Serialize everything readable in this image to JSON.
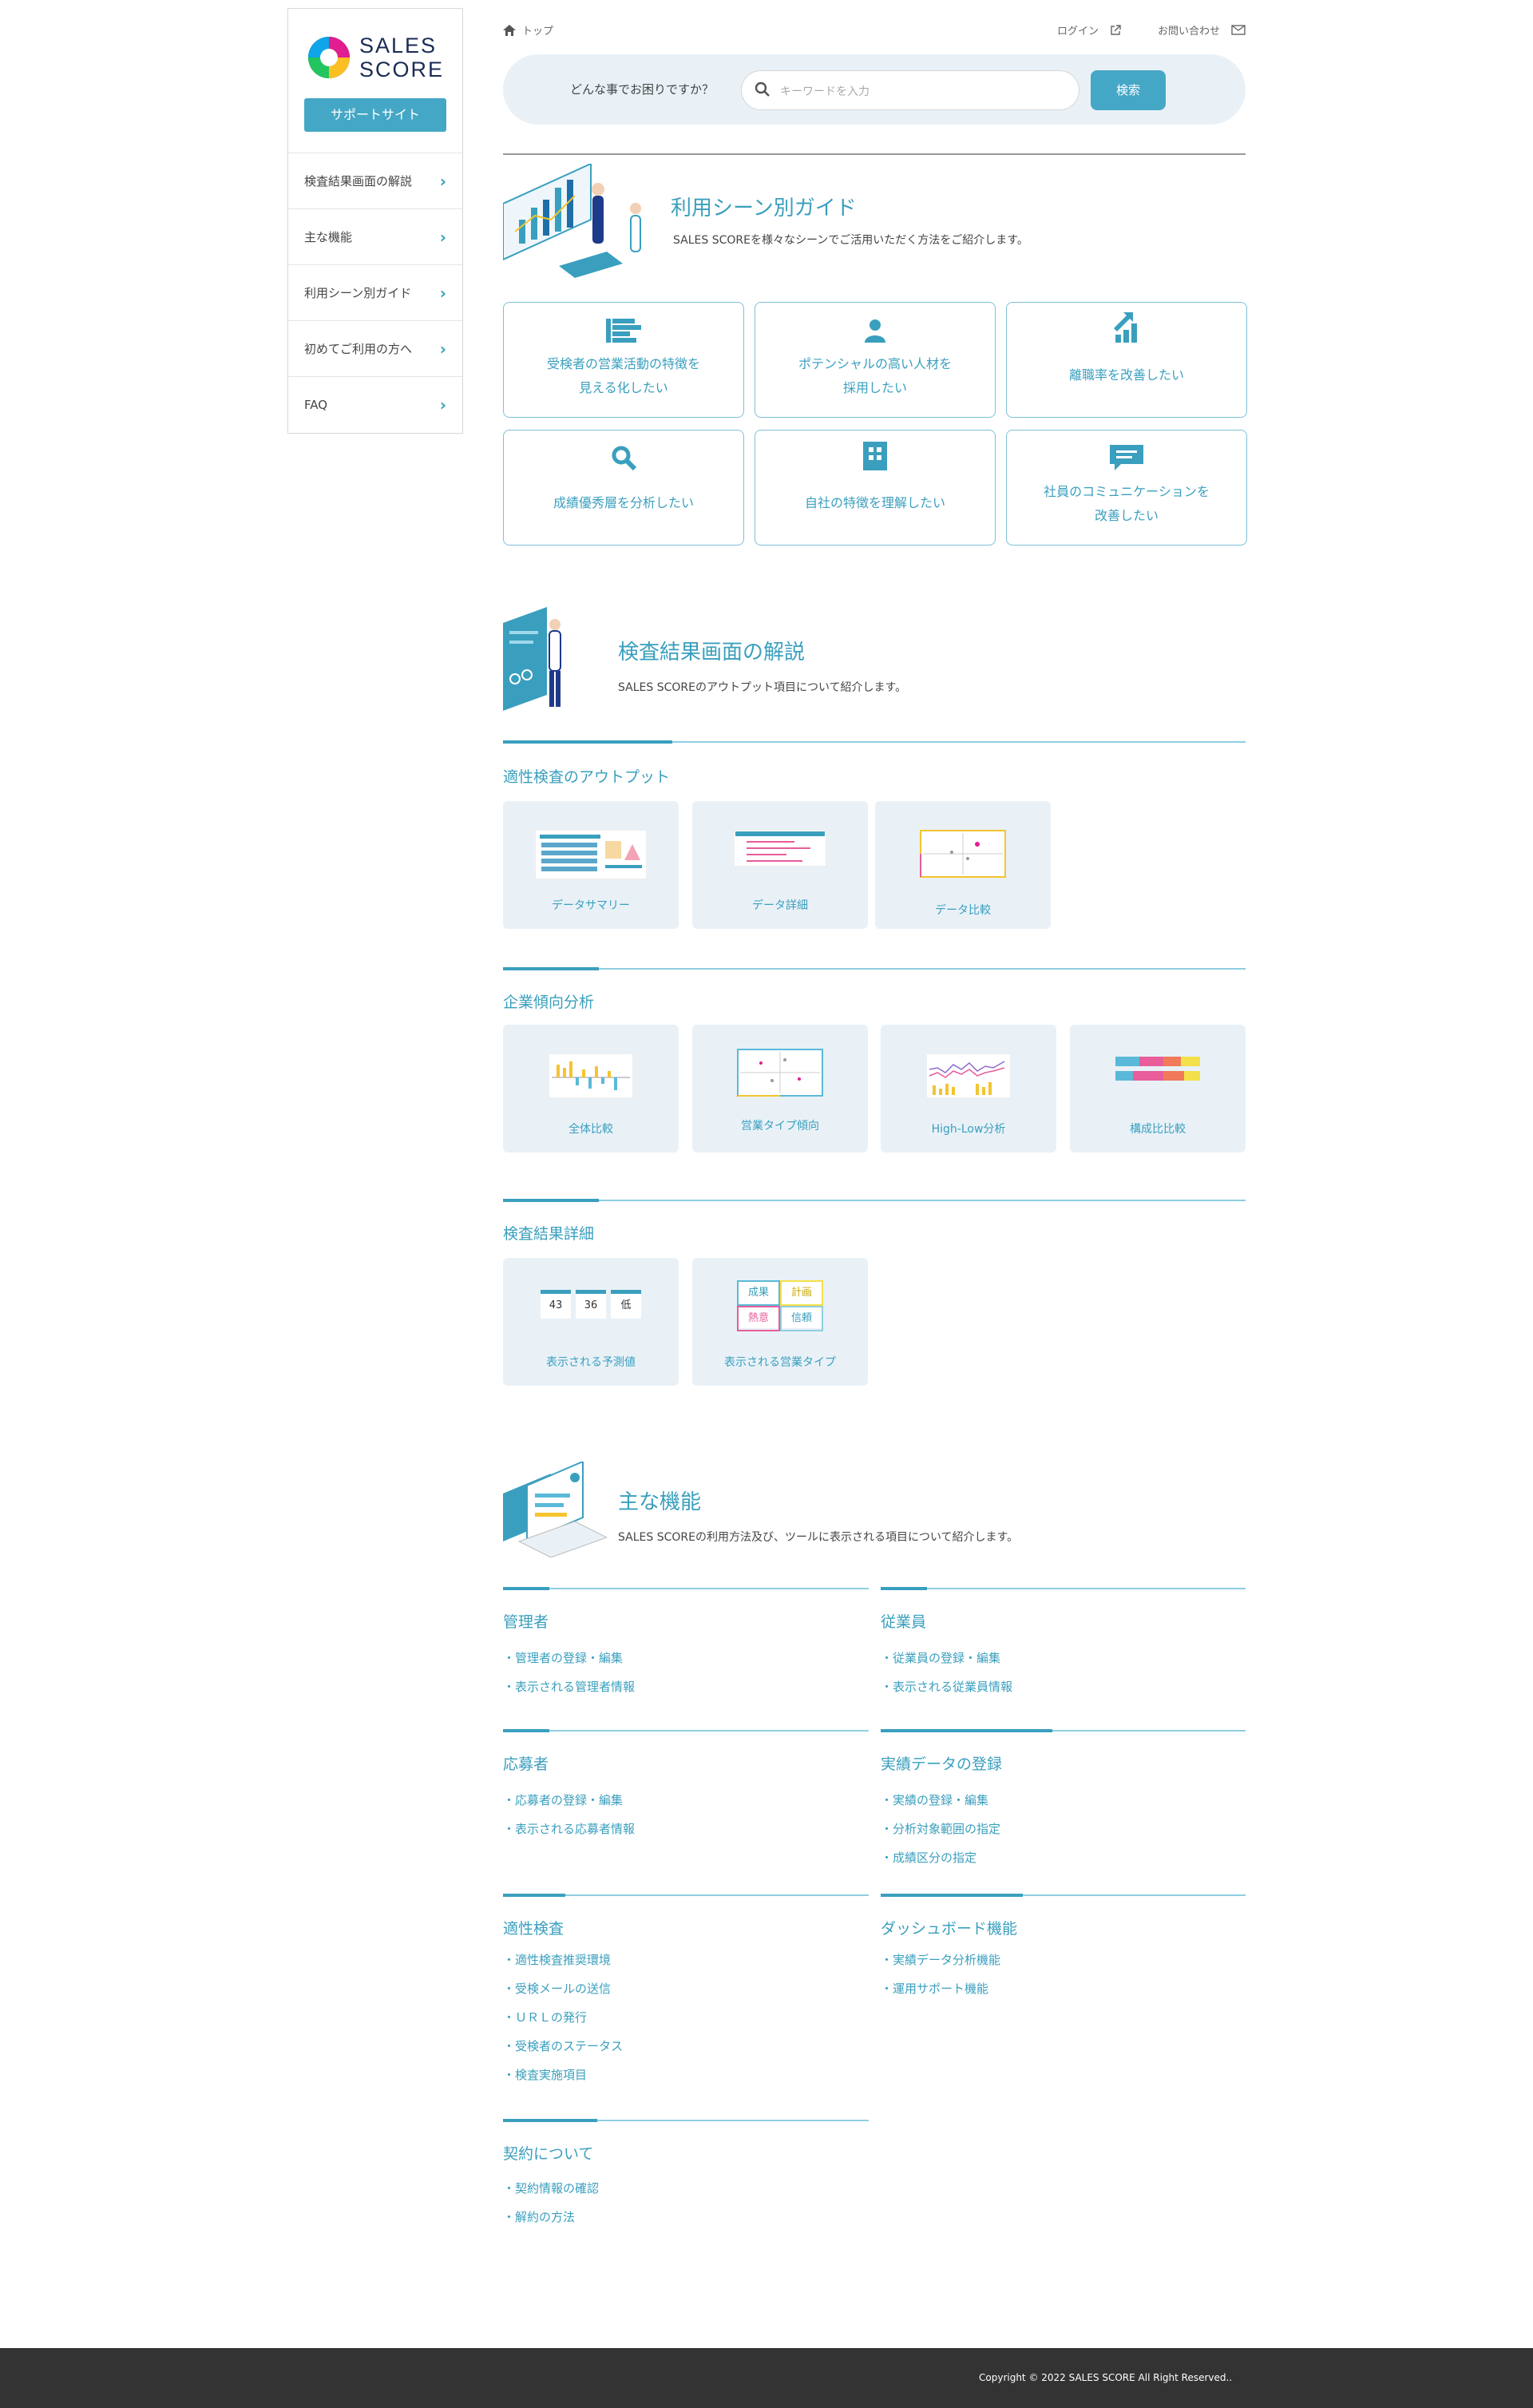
{
  "brand": {
    "logo_line1": "SALES",
    "logo_line2": "SCORE",
    "support_label": "サポートサイト"
  },
  "sidebar": {
    "items": [
      {
        "label": "検査結果画面の解説"
      },
      {
        "label": "主な機能"
      },
      {
        "label": "利用シーン別ガイド"
      },
      {
        "label": "初めてご利用の方へ"
      },
      {
        "label": "FAQ"
      }
    ]
  },
  "header": {
    "breadcrumb_home": "トップ",
    "login": "ログイン",
    "contact": "お問い合わせ"
  },
  "search": {
    "question": "どんな事でお困りですか？",
    "placeholder": "キーワードを入力",
    "button": "検索"
  },
  "guide": {
    "title": "利用シーン別ガイド",
    "desc": "SALES SCOREを様々なシーンでご活用いただく方法をご紹介します。",
    "cards": [
      {
        "line1": "受検者の営業活動の特徴を",
        "line2": "見える化したい",
        "icon": "bars-icon"
      },
      {
        "line1": "ポテンシャルの高い人材を",
        "line2": "採用したい",
        "icon": "person-icon"
      },
      {
        "line1": "離職率を改善したい",
        "line2": "",
        "icon": "growth-chart-icon"
      },
      {
        "line1": "成績優秀層を分析したい",
        "line2": "",
        "icon": "search-icon"
      },
      {
        "line1": "自社の特徴を理解したい",
        "line2": "",
        "icon": "building-icon"
      },
      {
        "line1": "社員のコミュニケーションを",
        "line2": "改善したい",
        "icon": "chat-icon"
      }
    ]
  },
  "results": {
    "title": "検査結果画面の解説",
    "desc": "SALES SCOREのアウトプット項目について紹介します。",
    "output_title": "適性検査のアウトプット",
    "output_cards": [
      {
        "label": "データサマリー"
      },
      {
        "label": "データ詳細"
      },
      {
        "label": "データ比較"
      }
    ],
    "trend_title": "企業傾向分析",
    "trend_cards": [
      {
        "label": "全体比較"
      },
      {
        "label": "営業タイプ傾向"
      },
      {
        "label": "High-Low分析"
      },
      {
        "label": "構成比比較"
      }
    ],
    "detail_title": "検査結果詳細",
    "detail_cards": [
      {
        "label": "表示される予測値"
      },
      {
        "label": "表示される営業タイプ"
      }
    ],
    "predict_values": [
      "43",
      "36",
      "低"
    ],
    "type_words": [
      "成果",
      "計画",
      "熱意",
      "信頼"
    ]
  },
  "features": {
    "title": "主な機能",
    "desc": "SALES SCOREの利用方法及び、ツールに表示される項目について紹介します。",
    "groups": [
      {
        "title": "管理者",
        "items": [
          "・管理者の登録・編集",
          "・表示される管理者情報"
        ]
      },
      {
        "title": "従業員",
        "items": [
          "・従業員の登録・編集",
          "・表示される従業員情報"
        ]
      },
      {
        "title": "応募者",
        "items": [
          "・応募者の登録・編集",
          "・表示される応募者情報"
        ]
      },
      {
        "title": "実績データの登録",
        "items": [
          "・実績の登録・編集",
          "・分析対象範囲の指定",
          "・成績区分の指定"
        ]
      },
      {
        "title": "適性検査",
        "items": [
          "・適性検査推奨環境",
          "・受検メールの送信",
          "・ＵＲＬの発行",
          "・受検者のステータス",
          "・検査実施項目"
        ]
      },
      {
        "title": "ダッシュボード機能",
        "items": [
          "・実績データ分析機能",
          "・運用サポート機能"
        ]
      },
      {
        "title": "契約について",
        "items": [
          "・契約情報の確認",
          "・解約の方法"
        ]
      }
    ]
  },
  "footer": {
    "copyright": "Copyright © 2022 SALES SCORE All Right Reserved.."
  },
  "colors": {
    "accent": "#3a9fbe",
    "button": "#45a7c6",
    "panel": "#e9f1f7",
    "footer": "#333333"
  }
}
